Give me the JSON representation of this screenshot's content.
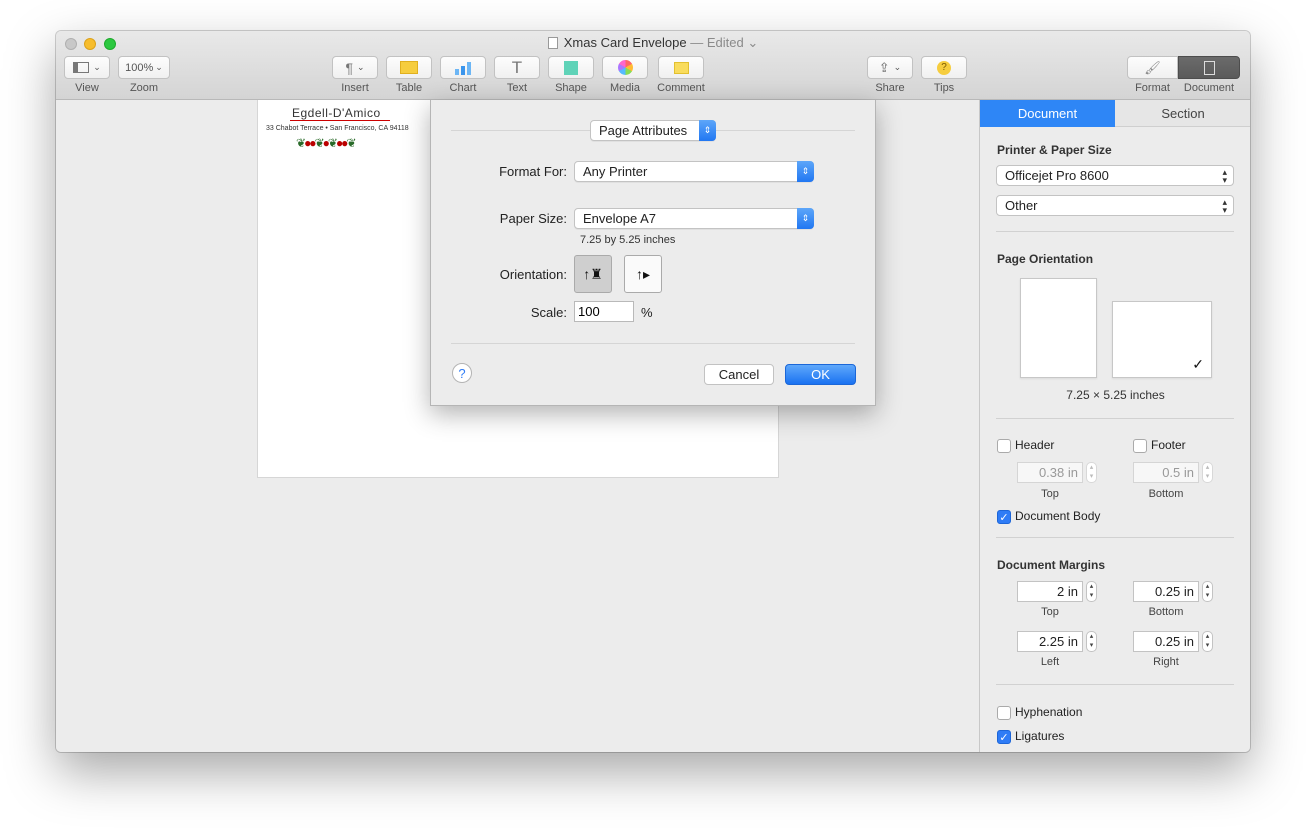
{
  "window": {
    "title": "Xmas Card Envelope",
    "edited": "— Edited ⌄"
  },
  "toolbar": {
    "view_label": "View",
    "zoom_value": "100%",
    "zoom_label": "Zoom",
    "insert_label": "Insert",
    "table_label": "Table",
    "chart_label": "Chart",
    "text_label": "Text",
    "shape_label": "Shape",
    "media_label": "Media",
    "comment_label": "Comment",
    "share_label": "Share",
    "tips_label": "Tips",
    "format_label": "Format",
    "document_label": "Document"
  },
  "envelope": {
    "name": "Egdell-D'Amico",
    "address": "33 Chabot Terrace • San Francisco, CA 94118"
  },
  "dialog": {
    "settings_popup": "Page Attributes",
    "format_for_label": "Format For:",
    "format_for_value": "Any Printer",
    "paper_size_label": "Paper Size:",
    "paper_size_value": "Envelope A7",
    "paper_dims": "7.25 by 5.25 inches",
    "orientation_label": "Orientation:",
    "scale_label": "Scale:",
    "scale_value": "100",
    "scale_unit": "%",
    "help": "?",
    "cancel": "Cancel",
    "ok": "OK"
  },
  "inspector": {
    "tab_document": "Document",
    "tab_section": "Section",
    "printer_heading": "Printer & Paper Size",
    "printer_value": "Officejet Pro 8600",
    "paper_value": "Other",
    "orientation_heading": "Page Orientation",
    "paper_dims": "7.25 × 5.25 inches",
    "header_label": "Header",
    "footer_label": "Footer",
    "header_value": "0.38 in",
    "footer_value": "0.5 in",
    "header_sub": "Top",
    "footer_sub": "Bottom",
    "document_body_label": "Document Body",
    "margins_heading": "Document Margins",
    "margin_top": "2 in",
    "margin_bottom": "0.25 in",
    "margin_left": "2.25 in",
    "margin_right": "0.25 in",
    "top_label": "Top",
    "bottom_label": "Bottom",
    "left_label": "Left",
    "right_label": "Right",
    "hyphenation_label": "Hyphenation",
    "ligatures_label": "Ligatures"
  },
  "colors": {
    "accent": "#2e86f6"
  }
}
